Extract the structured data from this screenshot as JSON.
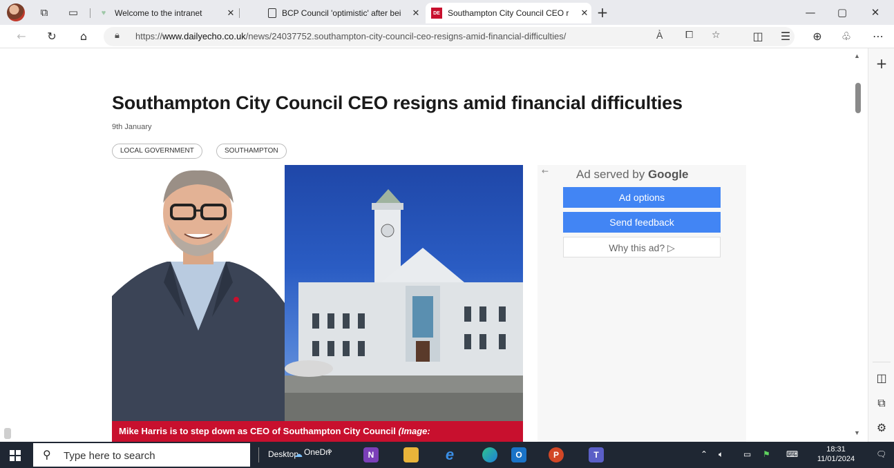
{
  "browser": {
    "tabs": [
      {
        "label": "Welcome to the intranet",
        "active": false
      },
      {
        "label": "BCP Council 'optimistic' after bei",
        "active": false
      },
      {
        "label": "Southampton City Council CEO r",
        "active": true
      }
    ],
    "new_tab": "+",
    "url_prefix": "https://",
    "url_domain": "www.dailyecho.co.uk",
    "url_path": "/news/24037752.southampton-city-council-ceo-resigns-amid-financial-difficulties/",
    "accent_color": "#c8102e"
  },
  "article": {
    "headline": "Southampton City Council CEO resigns amid financial difficulties",
    "date": "9th January",
    "tags": [
      "LOCAL GOVERNMENT",
      "SOUTHAMPTON"
    ],
    "caption": "Mike Harris is to step down as CEO of Southampton City Council ",
    "caption_credit": "(Image:"
  },
  "ad": {
    "served_by": "Ad served by ",
    "brand": "Google",
    "buttons": {
      "options": "Ad options",
      "feedback": "Send feedback",
      "why": "Why this ad? ▷"
    }
  },
  "taskbar": {
    "search_placeholder": "Type here to search",
    "desktop_label": "Desktop",
    "onedrive_label": "OneDri",
    "overflow": "»",
    "time": "18:31",
    "date": "11/01/2024"
  }
}
